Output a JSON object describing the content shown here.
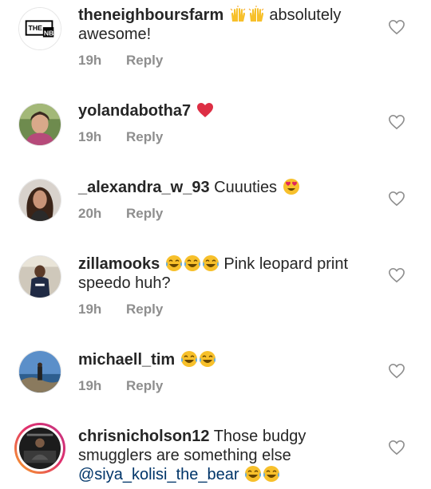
{
  "comments": [
    {
      "username": "theneighboursfarm",
      "text": "absolutely awesome!",
      "emojis_before_text": [
        "raising-hands-emoji",
        "raising-hands-emoji"
      ],
      "time": "19h",
      "reply_label": "Reply",
      "avatar_text": "THE NB"
    },
    {
      "username": "yolandabotha7",
      "text": "",
      "emojis_after_text": [
        "red-heart-emoji"
      ],
      "time": "19h",
      "reply_label": "Reply"
    },
    {
      "username": "_alexandra_w_93",
      "text": "Cuuuties",
      "emojis_after_text": [
        "heart-eyes-emoji"
      ],
      "time": "20h",
      "reply_label": "Reply"
    },
    {
      "username": "zillamooks",
      "text": "Pink leopard print speedo huh?",
      "emojis_before_text": [
        "tears-of-joy-emoji",
        "tears-of-joy-emoji",
        "tears-of-joy-emoji"
      ],
      "time": "19h",
      "reply_label": "Reply"
    },
    {
      "username": "michaell_tim",
      "text": "",
      "emojis_after_text": [
        "tears-of-joy-emoji",
        "tears-of-joy-emoji"
      ],
      "time": "19h",
      "reply_label": "Reply"
    },
    {
      "username": "chrisnicholson12",
      "text": "Those budgy smugglers are something else",
      "mention": "@siya_kolisi_the_bear",
      "emojis_after_text": [
        "tears-of-joy-emoji",
        "tears-of-joy-emoji"
      ],
      "has_story_ring": true
    }
  ],
  "colors": {
    "username": "#262626",
    "meta": "#8e8e8e",
    "mention": "#003569",
    "like_icon": "#8e8e8e"
  }
}
